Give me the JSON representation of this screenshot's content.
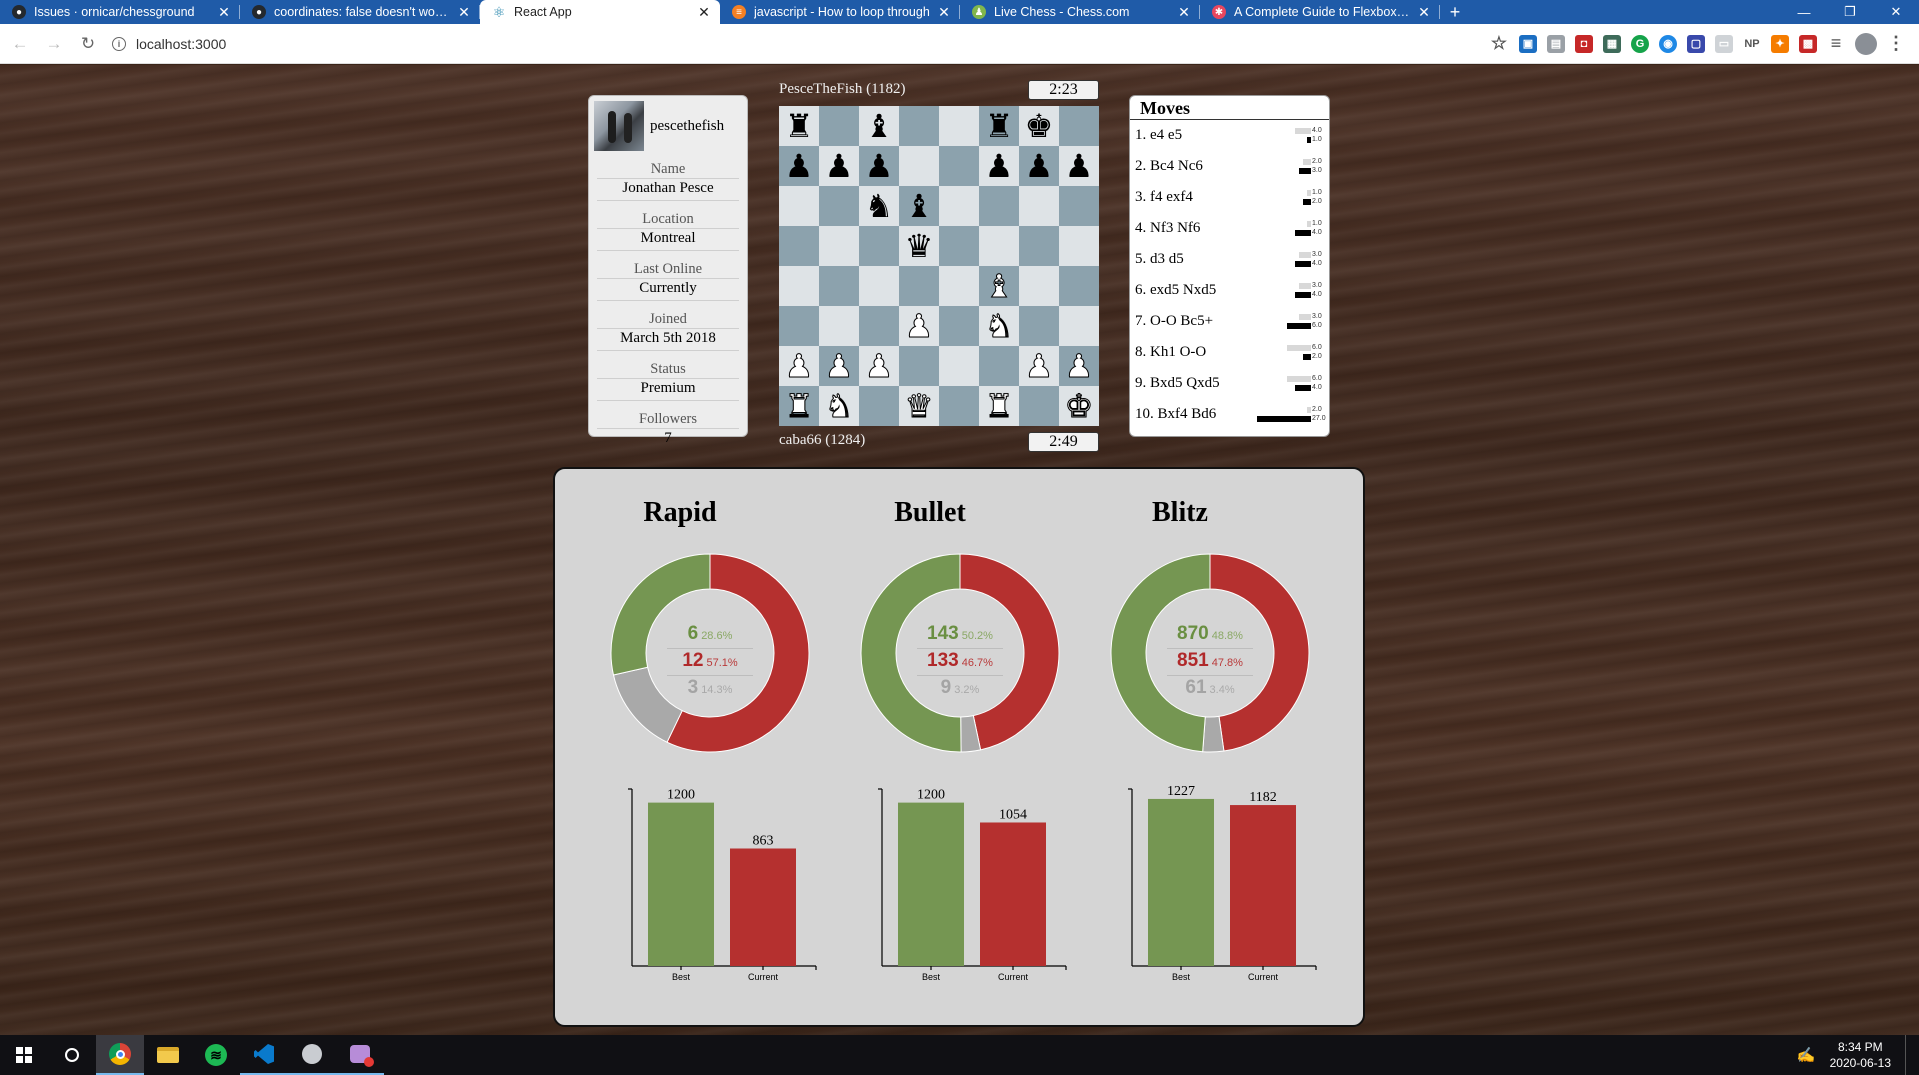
{
  "browser": {
    "tabs": [
      {
        "title": "Issues · ornicar/chessground",
        "favicon": "github-icon",
        "active": false
      },
      {
        "title": "coordinates: false doesn't work ·",
        "favicon": "github-icon",
        "active": false
      },
      {
        "title": "React App",
        "favicon": "react-icon",
        "active": true
      },
      {
        "title": "javascript - How to loop through",
        "favicon": "stackoverflow-icon",
        "active": false
      },
      {
        "title": "Live Chess - Chess.com",
        "favicon": "chesscom-icon",
        "active": false
      },
      {
        "title": "A Complete Guide to Flexbox | C",
        "favicon": "css-tricks-icon",
        "active": false
      }
    ],
    "url": "localhost:3000"
  },
  "profile": {
    "username": "pescethefish",
    "fields": [
      {
        "label": "Name",
        "value": "Jonathan Pesce"
      },
      {
        "label": "Location",
        "value": "Montreal"
      },
      {
        "label": "Last Online",
        "value": "Currently"
      },
      {
        "label": "Joined",
        "value": "March 5th 2018"
      },
      {
        "label": "Status",
        "value": "Premium"
      },
      {
        "label": "Followers",
        "value": "7"
      }
    ]
  },
  "game": {
    "top_player": "PesceTheFish (1182)",
    "top_clock": "2:23",
    "bottom_player": "caba66 (1284)",
    "bottom_clock": "2:49",
    "board": [
      [
        "br",
        "",
        "bb",
        "",
        "",
        "br",
        "bk",
        ""
      ],
      [
        "bp",
        "bp",
        "bp",
        "",
        "",
        "bp",
        "bp",
        "bp"
      ],
      [
        "",
        "",
        "bn",
        "bb",
        "",
        "",
        "",
        ""
      ],
      [
        "",
        "",
        "",
        "bq",
        "",
        "",
        "",
        ""
      ],
      [
        "",
        "",
        "",
        "",
        "",
        "wb",
        "",
        ""
      ],
      [
        "",
        "",
        "",
        "wp",
        "",
        "wn",
        "",
        ""
      ],
      [
        "wp",
        "wp",
        "wp",
        "",
        "",
        "",
        "wp",
        "wp"
      ],
      [
        "wr",
        "wn",
        "",
        "wq",
        "",
        "wr",
        "",
        "wk"
      ]
    ],
    "piece_glyphs": {
      "k": "♚",
      "q": "♛",
      "r": "♜",
      "b": "♝",
      "n": "♞",
      "p": "♟"
    }
  },
  "moves": {
    "title": "Moves",
    "list": [
      {
        "text": "1. e4 e5",
        "eval_top": "4.0",
        "eval_bot": "1.0",
        "w": 4,
        "b": 1
      },
      {
        "text": "2. Bc4 Nc6",
        "eval_top": "2.0",
        "eval_bot": "3.0",
        "w": 2,
        "b": 3
      },
      {
        "text": "3. f4 exf4",
        "eval_top": "1.0",
        "eval_bot": "2.0",
        "w": 1,
        "b": 2
      },
      {
        "text": "4. Nf3 Nf6",
        "eval_top": "1.0",
        "eval_bot": "4.0",
        "w": 1,
        "b": 4
      },
      {
        "text": "5. d3 d5",
        "eval_top": "3.0",
        "eval_bot": "4.0",
        "w": 3,
        "b": 4
      },
      {
        "text": "6. exd5 Nxd5",
        "eval_top": "3.0",
        "eval_bot": "4.0",
        "w": 3,
        "b": 4
      },
      {
        "text": "7. O-O Bc5+",
        "eval_top": "3.0",
        "eval_bot": "6.0",
        "w": 3,
        "b": 6
      },
      {
        "text": "8. Kh1 O-O",
        "eval_top": "6.0",
        "eval_bot": "2.0",
        "w": 6,
        "b": 2
      },
      {
        "text": "9. Bxd5 Qxd5",
        "eval_top": "6.0",
        "eval_bot": "4.0",
        "w": 6,
        "b": 4
      },
      {
        "text": "10. Bxf4 Bd6",
        "eval_top": "2.0",
        "eval_bot": "27.0",
        "w": 2,
        "b": 27
      }
    ]
  },
  "stats": [
    {
      "title": "Rapid",
      "wins": 6,
      "wins_pct": "28.6%",
      "losses": 12,
      "losses_pct": "57.1%",
      "draws": 3,
      "draws_pct": "14.3%",
      "ratings": [
        {
          "label": "Best",
          "value": 1200
        },
        {
          "label": "Current",
          "value": 863
        }
      ]
    },
    {
      "title": "Bullet",
      "wins": 143,
      "wins_pct": "50.2%",
      "losses": 133,
      "losses_pct": "46.7%",
      "draws": 9,
      "draws_pct": "3.2%",
      "ratings": [
        {
          "label": "Best",
          "value": 1200
        },
        {
          "label": "Current",
          "value": 1054
        }
      ]
    },
    {
      "title": "Blitz",
      "wins": 870,
      "wins_pct": "48.8%",
      "losses": 851,
      "losses_pct": "47.8%",
      "draws": 61,
      "draws_pct": "3.4%",
      "ratings": [
        {
          "label": "Best",
          "value": 1227
        },
        {
          "label": "Current",
          "value": 1182
        }
      ]
    }
  ],
  "colors": {
    "win": "#759652",
    "loss": "#b5302f",
    "draw": "#a9a9a9"
  },
  "taskbar": {
    "time": "8:34 PM",
    "date": "2020-06-13"
  }
}
